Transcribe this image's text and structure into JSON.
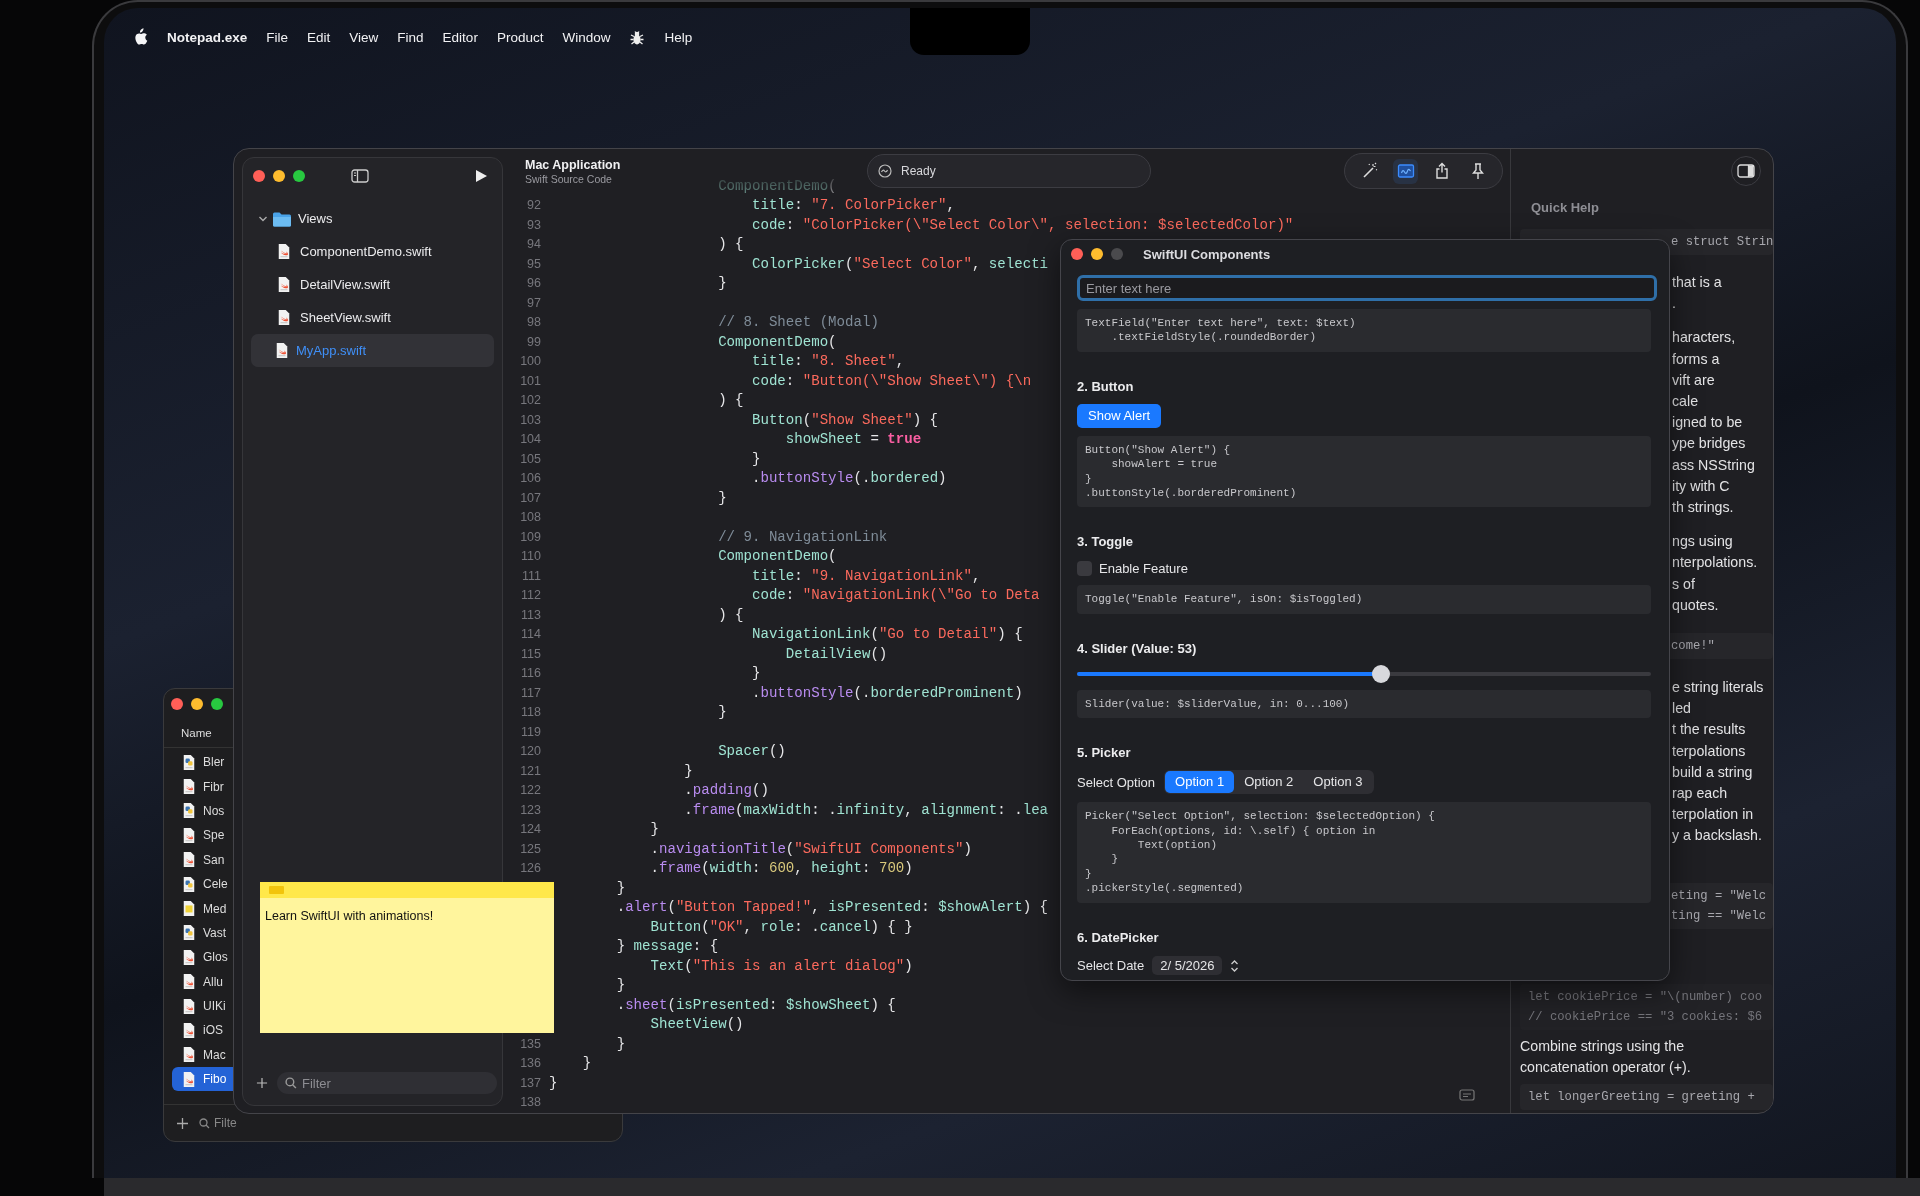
{
  "menu_bar": [
    {
      "kind": "apple"
    },
    {
      "kind": "app",
      "label": "Notepad.exe"
    },
    {
      "kind": "menu",
      "label": "File"
    },
    {
      "kind": "menu",
      "label": "Edit"
    },
    {
      "kind": "menu",
      "label": "View"
    },
    {
      "kind": "menu",
      "label": "Find"
    },
    {
      "kind": "menu",
      "label": "Editor"
    },
    {
      "kind": "menu",
      "label": "Product"
    },
    {
      "kind": "menu",
      "label": "Window"
    },
    {
      "kind": "bug"
    },
    {
      "kind": "menu",
      "label": "Help"
    }
  ],
  "file_window": {
    "header": "Name",
    "rows": [
      {
        "name": "Bler",
        "kind": "python",
        "selected": false
      },
      {
        "name": "Fibr",
        "kind": "swift",
        "selected": false
      },
      {
        "name": "Nos",
        "kind": "python",
        "selected": false
      },
      {
        "name": "Spe",
        "kind": "swift",
        "selected": false
      },
      {
        "name": "San",
        "kind": "swift",
        "selected": false
      },
      {
        "name": "Cele",
        "kind": "python",
        "selected": false
      },
      {
        "name": "Med",
        "kind": "js",
        "selected": false
      },
      {
        "name": "Vast",
        "kind": "python",
        "selected": false
      },
      {
        "name": "Glos",
        "kind": "swift",
        "selected": false
      },
      {
        "name": "Allu",
        "kind": "swift",
        "selected": false
      },
      {
        "name": "UIKi",
        "kind": "swift",
        "selected": false
      },
      {
        "name": "iOS",
        "kind": "swift",
        "selected": false
      },
      {
        "name": "Mac",
        "kind": "swift",
        "selected": false
      },
      {
        "name": "Fibo",
        "kind": "swift",
        "selected": true
      }
    ],
    "filter_placeholder": "Filte"
  },
  "xcode": {
    "navigator": {
      "items": [
        {
          "label": "Views",
          "kind": "folder",
          "expanded": true,
          "selected": false,
          "children": [
            {
              "label": "ComponentDemo.swift",
              "kind": "swift",
              "selected": false
            },
            {
              "label": "DetailView.swift",
              "kind": "swift",
              "selected": false
            },
            {
              "label": "SheetView.swift",
              "kind": "swift",
              "selected": false
            }
          ]
        },
        {
          "label": "MyApp.swift",
          "kind": "swift",
          "selected": true
        }
      ],
      "filter_placeholder": "Filter"
    },
    "editor": {
      "title": "Mac Application",
      "subtitle": "Swift Source Code",
      "status": "Ready",
      "toolbar": [
        {
          "kind": "wand",
          "selected": false
        },
        {
          "kind": "canvas",
          "selected": true
        },
        {
          "kind": "share",
          "selected": false
        },
        {
          "kind": "pin",
          "selected": false
        }
      ],
      "lines": [
        {
          "faded": true,
          "tokens": [
            {
              "kind": "ident",
              "text": "                    ComponentDemo"
            },
            {
              "kind": "plain",
              "text": "("
            }
          ]
        },
        {
          "num": "92",
          "faded": false,
          "tokens": [
            {
              "kind": "ident",
              "text": "                        title"
            },
            {
              "kind": "plain",
              "text": ": "
            },
            {
              "kind": "string",
              "text": "\"7. ColorPicker\""
            },
            {
              "kind": "plain",
              "text": ","
            }
          ]
        },
        {
          "num": "93",
          "faded": false,
          "tokens": [
            {
              "kind": "ident",
              "text": "                        code"
            },
            {
              "kind": "plain",
              "text": ": "
            },
            {
              "kind": "string",
              "text": "\"ColorPicker(\\\"Select Color\\\", selection: $selectedColor)\""
            }
          ]
        },
        {
          "num": "94",
          "faded": false,
          "tokens": [
            {
              "kind": "plain",
              "text": "                    ) {"
            }
          ]
        },
        {
          "num": "95",
          "faded": false,
          "tokens": [
            {
              "kind": "ident",
              "text": "                        ColorPicker"
            },
            {
              "kind": "plain",
              "text": "("
            },
            {
              "kind": "string",
              "text": "\"Select Color\""
            },
            {
              "kind": "plain",
              "text": ", "
            },
            {
              "kind": "ident",
              "text": "selecti"
            }
          ]
        },
        {
          "num": "96",
          "faded": false,
          "tokens": [
            {
              "kind": "plain",
              "text": "                    }"
            }
          ]
        },
        {
          "num": "97"
        },
        {
          "num": "98",
          "faded": false,
          "tokens": [
            {
              "kind": "comment",
              "text": "                    // 8. Sheet (Modal)"
            }
          ]
        },
        {
          "num": "99",
          "faded": false,
          "tokens": [
            {
              "kind": "ident",
              "text": "                    ComponentDemo"
            },
            {
              "kind": "plain",
              "text": "("
            }
          ]
        },
        {
          "num": "100",
          "faded": false,
          "tokens": [
            {
              "kind": "ident",
              "text": "                        title"
            },
            {
              "kind": "plain",
              "text": ": "
            },
            {
              "kind": "string",
              "text": "\"8. Sheet\""
            },
            {
              "kind": "plain",
              "text": ","
            }
          ]
        },
        {
          "num": "101",
          "faded": false,
          "tokens": [
            {
              "kind": "ident",
              "text": "                        code"
            },
            {
              "kind": "plain",
              "text": ": "
            },
            {
              "kind": "string",
              "text": "\"Button(\\\"Show Sheet\\\") {\\n"
            }
          ]
        },
        {
          "num": "102",
          "faded": false,
          "tokens": [
            {
              "kind": "plain",
              "text": "                    ) {"
            }
          ]
        },
        {
          "num": "103",
          "faded": false,
          "tokens": [
            {
              "kind": "ident",
              "text": "                        Button"
            },
            {
              "kind": "plain",
              "text": "("
            },
            {
              "kind": "string",
              "text": "\"Show Sheet\""
            },
            {
              "kind": "plain",
              "text": ") {"
            }
          ]
        },
        {
          "num": "104",
          "faded": false,
          "tokens": [
            {
              "kind": "ident",
              "text": "                            showSheet"
            },
            {
              "kind": "plain",
              "text": " = "
            },
            {
              "kind": "keyword",
              "text": "true"
            }
          ]
        },
        {
          "num": "105",
          "faded": false,
          "tokens": [
            {
              "kind": "plain",
              "text": "                        }"
            }
          ]
        },
        {
          "num": "106",
          "faded": false,
          "tokens": [
            {
              "kind": "plain",
              "text": "                        ."
            },
            {
              "kind": "method",
              "text": "buttonStyle"
            },
            {
              "kind": "plain",
              "text": "(."
            },
            {
              "kind": "ident",
              "text": "bordered"
            },
            {
              "kind": "plain",
              "text": ")"
            }
          ]
        },
        {
          "num": "107",
          "faded": false,
          "tokens": [
            {
              "kind": "plain",
              "text": "                    }"
            }
          ]
        },
        {
          "num": "108"
        },
        {
          "num": "109",
          "faded": false,
          "tokens": [
            {
              "kind": "comment",
              "text": "                    // 9. NavigationLink"
            }
          ]
        },
        {
          "num": "110",
          "faded": false,
          "tokens": [
            {
              "kind": "ident",
              "text": "                    ComponentDemo"
            },
            {
              "kind": "plain",
              "text": "("
            }
          ]
        },
        {
          "num": "111",
          "faded": false,
          "tokens": [
            {
              "kind": "ident",
              "text": "                        title"
            },
            {
              "kind": "plain",
              "text": ": "
            },
            {
              "kind": "string",
              "text": "\"9. NavigationLink\""
            },
            {
              "kind": "plain",
              "text": ","
            }
          ]
        },
        {
          "num": "112",
          "faded": false,
          "tokens": [
            {
              "kind": "ident",
              "text": "                        code"
            },
            {
              "kind": "plain",
              "text": ": "
            },
            {
              "kind": "string",
              "text": "\"NavigationLink(\\\"Go to Deta"
            }
          ]
        },
        {
          "num": "113",
          "faded": false,
          "tokens": [
            {
              "kind": "plain",
              "text": "                    ) {"
            }
          ]
        },
        {
          "num": "114",
          "faded": false,
          "tokens": [
            {
              "kind": "ident",
              "text": "                        NavigationLink"
            },
            {
              "kind": "plain",
              "text": "("
            },
            {
              "kind": "string",
              "text": "\"Go to Detail\""
            },
            {
              "kind": "plain",
              "text": ") {"
            }
          ]
        },
        {
          "num": "115",
          "faded": false,
          "tokens": [
            {
              "kind": "ident",
              "text": "                            DetailView"
            },
            {
              "kind": "plain",
              "text": "()"
            }
          ]
        },
        {
          "num": "116",
          "faded": false,
          "tokens": [
            {
              "kind": "plain",
              "text": "                        }"
            }
          ]
        },
        {
          "num": "117",
          "faded": false,
          "tokens": [
            {
              "kind": "plain",
              "text": "                        ."
            },
            {
              "kind": "method",
              "text": "buttonStyle"
            },
            {
              "kind": "plain",
              "text": "(."
            },
            {
              "kind": "ident",
              "text": "borderedProminent"
            },
            {
              "kind": "plain",
              "text": ")"
            }
          ]
        },
        {
          "num": "118",
          "faded": false,
          "tokens": [
            {
              "kind": "plain",
              "text": "                    }"
            }
          ]
        },
        {
          "num": "119"
        },
        {
          "num": "120",
          "faded": false,
          "tokens": [
            {
              "kind": "ident",
              "text": "                    Spacer"
            },
            {
              "kind": "plain",
              "text": "()"
            }
          ]
        },
        {
          "num": "121",
          "faded": false,
          "tokens": [
            {
              "kind": "plain",
              "text": "                }"
            }
          ]
        },
        {
          "num": "122",
          "faded": false,
          "tokens": [
            {
              "kind": "plain",
              "text": "                ."
            },
            {
              "kind": "method",
              "text": "padding"
            },
            {
              "kind": "plain",
              "text": "()"
            }
          ]
        },
        {
          "num": "123",
          "faded": false,
          "tokens": [
            {
              "kind": "plain",
              "text": "                ."
            },
            {
              "kind": "method",
              "text": "frame"
            },
            {
              "kind": "plain",
              "text": "("
            },
            {
              "kind": "ident",
              "text": "maxWidth"
            },
            {
              "kind": "plain",
              "text": ": ."
            },
            {
              "kind": "ident",
              "text": "infinity"
            },
            {
              "kind": "plain",
              "text": ", "
            },
            {
              "kind": "ident",
              "text": "alignment"
            },
            {
              "kind": "plain",
              "text": ": ."
            },
            {
              "kind": "ident",
              "text": "lea"
            }
          ]
        },
        {
          "num": "124",
          "faded": false,
          "tokens": [
            {
              "kind": "plain",
              "text": "            }"
            }
          ]
        },
        {
          "num": "125",
          "faded": false,
          "tokens": [
            {
              "kind": "plain",
              "text": "            ."
            },
            {
              "kind": "method",
              "text": "navigationTitle"
            },
            {
              "kind": "plain",
              "text": "("
            },
            {
              "kind": "string",
              "text": "\"SwiftUI Components\""
            },
            {
              "kind": "plain",
              "text": ")"
            }
          ]
        },
        {
          "num": "126",
          "faded": false,
          "tokens": [
            {
              "kind": "plain",
              "text": "            ."
            },
            {
              "kind": "method",
              "text": "frame"
            },
            {
              "kind": "plain",
              "text": "("
            },
            {
              "kind": "ident",
              "text": "width"
            },
            {
              "kind": "plain",
              "text": ": "
            },
            {
              "kind": "number",
              "text": "600"
            },
            {
              "kind": "plain",
              "text": ", "
            },
            {
              "kind": "ident",
              "text": "height"
            },
            {
              "kind": "plain",
              "text": ": "
            },
            {
              "kind": "number",
              "text": "700"
            },
            {
              "kind": "plain",
              "text": ")"
            }
          ]
        },
        {
          "faded": false,
          "tokens": [
            {
              "kind": "plain",
              "text": "        }"
            }
          ]
        },
        {
          "faded": false,
          "tokens": [
            {
              "kind": "plain",
              "text": "        ."
            },
            {
              "kind": "method",
              "text": "alert"
            },
            {
              "kind": "plain",
              "text": "("
            },
            {
              "kind": "string",
              "text": "\"Button Tapped!\""
            },
            {
              "kind": "plain",
              "text": ", "
            },
            {
              "kind": "ident",
              "text": "isPresented"
            },
            {
              "kind": "plain",
              "text": ": "
            },
            {
              "kind": "ident",
              "text": "$showAlert"
            },
            {
              "kind": "plain",
              "text": ") {"
            }
          ]
        },
        {
          "faded": false,
          "tokens": [
            {
              "kind": "ident",
              "text": "            Button"
            },
            {
              "kind": "plain",
              "text": "("
            },
            {
              "kind": "string",
              "text": "\"OK\""
            },
            {
              "kind": "plain",
              "text": ", "
            },
            {
              "kind": "ident",
              "text": "role"
            },
            {
              "kind": "plain",
              "text": ": ."
            },
            {
              "kind": "ident",
              "text": "cancel"
            },
            {
              "kind": "plain",
              "text": ") { }"
            }
          ]
        },
        {
          "faded": false,
          "tokens": [
            {
              "kind": "plain",
              "text": "        } "
            },
            {
              "kind": "ident",
              "text": "message"
            },
            {
              "kind": "plain",
              "text": ": {"
            }
          ]
        },
        {
          "faded": false,
          "tokens": [
            {
              "kind": "ident",
              "text": "            Text"
            },
            {
              "kind": "plain",
              "text": "("
            },
            {
              "kind": "string",
              "text": "\"This is an alert dialog\""
            },
            {
              "kind": "plain",
              "text": ")"
            }
          ]
        },
        {
          "faded": false,
          "tokens": [
            {
              "kind": "plain",
              "text": "        }"
            }
          ]
        },
        {
          "faded": false,
          "tokens": [
            {
              "kind": "plain",
              "text": "        ."
            },
            {
              "kind": "method",
              "text": "sheet"
            },
            {
              "kind": "plain",
              "text": "("
            },
            {
              "kind": "ident",
              "text": "isPresented"
            },
            {
              "kind": "plain",
              "text": ": "
            },
            {
              "kind": "ident",
              "text": "$showSheet"
            },
            {
              "kind": "plain",
              "text": ") {"
            }
          ]
        },
        {
          "faded": false,
          "tokens": [
            {
              "kind": "ident",
              "text": "            SheetView"
            },
            {
              "kind": "plain",
              "text": "()"
            }
          ]
        },
        {
          "num": "135",
          "faded": false,
          "tokens": [
            {
              "kind": "plain",
              "text": "        }"
            }
          ]
        },
        {
          "num": "136",
          "faded": false,
          "tokens": [
            {
              "kind": "plain",
              "text": "    }"
            }
          ]
        },
        {
          "num": "137",
          "faded": false,
          "tokens": [
            {
              "kind": "plain",
              "text": "}"
            }
          ]
        },
        {
          "num": "138"
        }
      ]
    },
    "inspector": {
      "title": "Quick Help",
      "blocks": [
        {
          "kind": "code",
          "partly_hidden": true,
          "lines": [
            "e struct Strin"
          ]
        },
        {
          "kind": "text",
          "partly_hidden": true,
          "lines": [
            "that is a",
            "."
          ]
        },
        {
          "kind": "text",
          "partly_hidden": true,
          "lines": [
            "haracters,",
            "forms a",
            "vift are",
            "cale",
            "igned to be",
            "ype bridges",
            "ass NSString",
            "ity with C",
            "th strings."
          ]
        },
        {
          "kind": "text",
          "partly_hidden": true,
          "lines": [
            "ngs using",
            "nterpolations.",
            "s of",
            "quotes."
          ]
        },
        {
          "kind": "code",
          "partly_hidden": true,
          "lines": [
            "come!\""
          ]
        },
        {
          "kind": "text",
          "partly_hidden": true,
          "lines": [
            "e string literals",
            "led",
            "t the results",
            "terpolations",
            "build a string",
            "rap each",
            "terpolation in",
            "y a backslash."
          ]
        },
        {
          "kind": "code",
          "partly_hidden": true,
          "lines": [
            "eting = \"Welc",
            "ting == \"Welc"
          ]
        },
        {
          "kind": "code",
          "partly_hidden": false,
          "lines": [
            "let cookiePrice = \"\\(number) coo",
            "// cookiePrice == \"3 cookies: $6"
          ]
        },
        {
          "kind": "text",
          "partly_hidden": false,
          "lines": [
            "Combine strings using the",
            "concatenation operator (+)."
          ]
        },
        {
          "kind": "code",
          "partly_hidden": false,
          "lines": [
            "let longerGreeting = greeting +"
          ]
        }
      ]
    }
  },
  "preview_window": {
    "title": "SwiftUI Components",
    "zoom_disabled": true,
    "sections": [
      {
        "control": {
          "kind": "textfield",
          "placeholder": "Enter text here",
          "focused": true
        },
        "code": [
          "TextField(\"Enter text here\", text: $text)",
          "    .textFieldStyle(.roundedBorder)"
        ]
      },
      {
        "heading": "2. Button",
        "control": {
          "kind": "button",
          "label": "Show Alert"
        },
        "code": [
          "Button(\"Show Alert\") {",
          "    showAlert = true",
          "}",
          ".buttonStyle(.borderedProminent)"
        ]
      },
      {
        "heading": "3. Toggle",
        "control": {
          "kind": "toggle",
          "label": "Enable Feature",
          "checked": false
        },
        "code": [
          "Toggle(\"Enable Feature\", isOn: $isToggled)"
        ]
      },
      {
        "heading": "4. Slider (Value: 53)",
        "control": {
          "kind": "slider",
          "level": 0.53
        },
        "code": [
          "Slider(value: $sliderValue, in: 0...100)"
        ]
      },
      {
        "heading": "5. Picker",
        "control": {
          "kind": "picker",
          "label": "Select Option",
          "options": [
            {
              "label": "Option 1",
              "selected": true
            },
            {
              "label": "Option 2",
              "selected": false
            },
            {
              "label": "Option 3",
              "selected": false
            }
          ]
        },
        "code": [
          "Picker(\"Select Option\", selection: $selectedOption) {",
          "    ForEach(options, id: \\.self) { option in",
          "        Text(option)",
          "    }",
          "}",
          ".pickerStyle(.segmented)"
        ]
      },
      {
        "heading": "6. DatePicker",
        "control": {
          "kind": "datepicker",
          "label": "Select Date",
          "value": "2/ 5/2026"
        }
      }
    ]
  },
  "sticky_note": {
    "text": "Learn SwiftUI with animations!"
  }
}
